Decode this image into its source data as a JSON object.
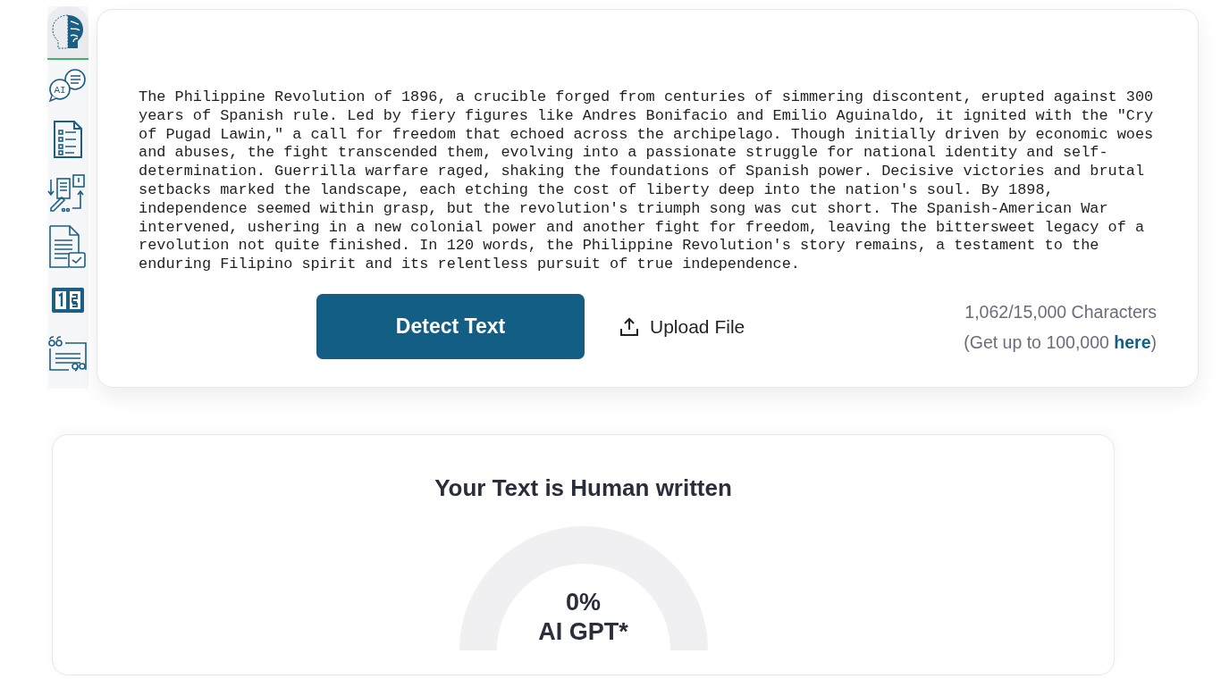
{
  "sidebar": {
    "items": [
      {
        "kind": "brain",
        "selected": true
      },
      {
        "kind": "ai-chat",
        "selected": false,
        "badge": "AI"
      },
      {
        "kind": "checklist",
        "selected": false
      },
      {
        "kind": "flow",
        "selected": false
      },
      {
        "kind": "doc-check",
        "selected": false
      },
      {
        "kind": "numbers",
        "selected": false
      },
      {
        "kind": "quote",
        "selected": false
      }
    ]
  },
  "editor": {
    "value": "The Philippine Revolution of 1896, a crucible forged from centuries of simmering discontent, erupted against 300 years of Spanish rule. Led by fiery figures like Andres Bonifacio and Emilio Aguinaldo, it ignited with the \"Cry of Pugad Lawin,\" a call for freedom that echoed across the archipelago. Though initially driven by economic woes and abuses, the fight transcended them, evolving into a passionate struggle for national identity and self-determination. Guerrilla warfare raged, shaking the foundations of Spanish power. Decisive victories and brutal setbacks marked the landscape, each etching the cost of liberty deep into the nation's soul. By 1898, independence seemed within grasp, but the revolution's triumph song was cut short. The Spanish-American War intervened, ushering in a new colonial power and another fight for freedom, leaving the bittersweet legacy of a revolution not quite finished. In 120 words, the Philippine Revolution's story remains, a testament to the enduring Filipino spirit and its relentless pursuit of true independence.",
    "detect_button": "Detect Text",
    "upload_button": "Upload File",
    "char_count": "1,062/15,000 Characters",
    "upgrade_prefix": "(Get up to 100,000",
    "upgrade_link": "here",
    "upgrade_suffix": ")"
  },
  "result": {
    "title": "Your Text is Human written",
    "gauge": {
      "percent": "0%",
      "label": "AI GPT*"
    }
  }
}
